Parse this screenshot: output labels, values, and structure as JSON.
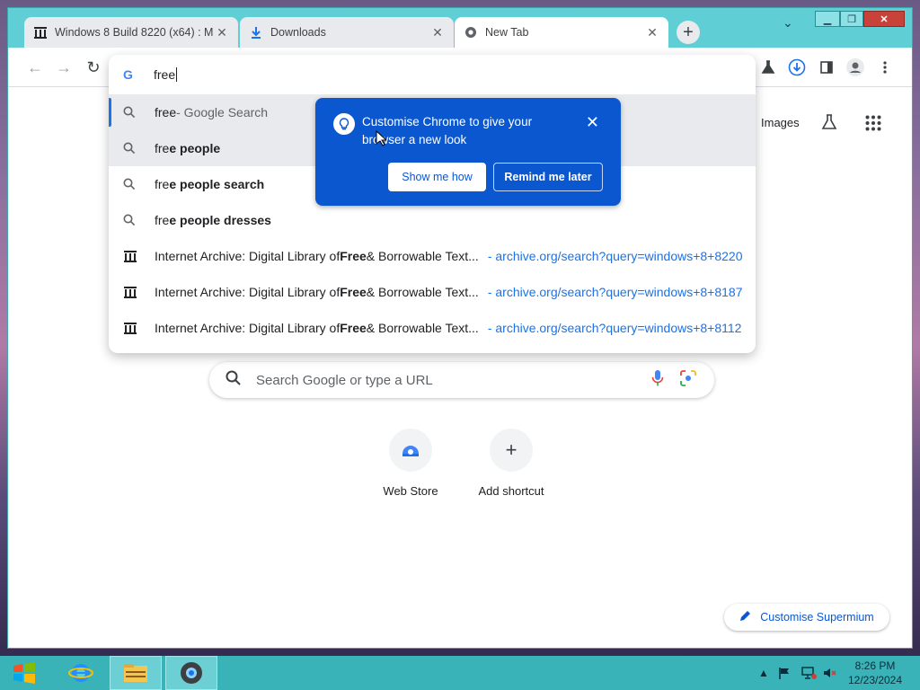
{
  "tabs": [
    {
      "title": "Windows 8 Build 8220 (x64) : M",
      "icon": "archive-icon"
    },
    {
      "title": "Downloads",
      "icon": "download-icon"
    },
    {
      "title": "New Tab",
      "icon": "chrome-icon"
    }
  ],
  "omnibox": {
    "input_value": "free",
    "suggestions": [
      {
        "prefix": "free",
        "bold": "",
        "suffix": " - Google Search",
        "url": "",
        "type": "search"
      },
      {
        "prefix": "fre",
        "bold": "e people",
        "suffix": "",
        "url": "",
        "type": "search"
      },
      {
        "prefix": "fre",
        "bold": "e people search",
        "suffix": "",
        "url": "",
        "type": "search"
      },
      {
        "prefix": "fre",
        "bold": "e people dresses",
        "suffix": "",
        "url": "",
        "type": "search"
      },
      {
        "prefix": "Internet Archive: Digital Library of ",
        "bold": "Free",
        "suffix": " & Borrowable Text...",
        "url": "- archive.org/search?query=windows+8+8220",
        "type": "history"
      },
      {
        "prefix": "Internet Archive: Digital Library of ",
        "bold": "Free",
        "suffix": " & Borrowable Text...",
        "url": "- archive.org/search?query=windows+8+8187",
        "type": "history"
      },
      {
        "prefix": "Internet Archive: Digital Library of ",
        "bold": "Free",
        "suffix": " & Borrowable Text...",
        "url": "- archive.org/search?query=windows+8+8112",
        "type": "history"
      }
    ]
  },
  "bubble": {
    "text": "Customise Chrome to give your browser a new look",
    "primary": "Show me how",
    "secondary": "Remind me later"
  },
  "ntp": {
    "images_link": "Images",
    "search_placeholder": "Search Google or type a URL",
    "shortcuts": [
      {
        "label": "Web Store"
      },
      {
        "label": "Add shortcut"
      }
    ],
    "customise": "Customise Supermium"
  },
  "clock": {
    "time": "8:26 PM",
    "date": "12/23/2024"
  },
  "colors": {
    "accent": "#0b57d0",
    "frame": "#5fcfd5",
    "taskbar": "#3ab3b8"
  }
}
